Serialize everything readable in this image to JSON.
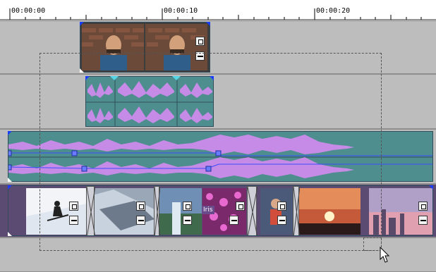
{
  "ruler": {
    "labels": [
      "00:00:00",
      "00:00:10",
      "00:00:20"
    ]
  },
  "transition": {
    "tooltip": "Iris"
  },
  "icons": {
    "crop": "crop-icon",
    "pan": "pan-zoom-icon",
    "cursor": "mouse-pointer-icon"
  },
  "colors": {
    "video_track_bg": "#5b4a72",
    "audio_clip": "#4f8e8e",
    "waveform": "#c58be6",
    "in_marker": "#1a3cff",
    "sync_marker": "#55d6e6"
  }
}
